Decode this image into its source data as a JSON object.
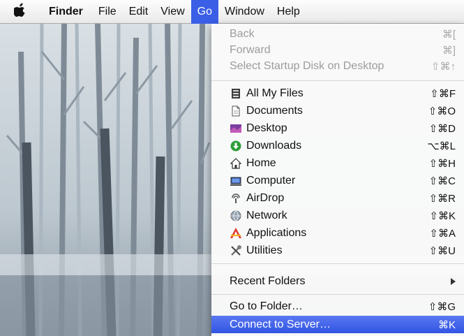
{
  "menubar": {
    "apple_icon": "apple-logo-icon",
    "items": [
      {
        "label": "Finder"
      },
      {
        "label": "File"
      },
      {
        "label": "Edit"
      },
      {
        "label": "View"
      },
      {
        "label": "Go"
      },
      {
        "label": "Window"
      },
      {
        "label": "Help"
      }
    ],
    "active_menu": "Go",
    "accent": "#3a5fe6"
  },
  "go_menu": {
    "history": [
      {
        "label": "Back",
        "shortcut": "⌘[",
        "enabled": false
      },
      {
        "label": "Forward",
        "shortcut": "⌘]",
        "enabled": false
      },
      {
        "label": "Select Startup Disk on Desktop",
        "shortcut": "⇧⌘↑",
        "enabled": false
      }
    ],
    "places": [
      {
        "label": "All My Files",
        "shortcut": "⇧⌘F",
        "icon": "all-my-files-icon"
      },
      {
        "label": "Documents",
        "shortcut": "⇧⌘O",
        "icon": "documents-icon"
      },
      {
        "label": "Desktop",
        "shortcut": "⇧⌘D",
        "icon": "desktop-icon"
      },
      {
        "label": "Downloads",
        "shortcut": "⌥⌘L",
        "icon": "downloads-icon"
      },
      {
        "label": "Home",
        "shortcut": "⇧⌘H",
        "icon": "home-icon"
      },
      {
        "label": "Computer",
        "shortcut": "⇧⌘C",
        "icon": "computer-icon"
      },
      {
        "label": "AirDrop",
        "shortcut": "⇧⌘R",
        "icon": "airdrop-icon"
      },
      {
        "label": "Network",
        "shortcut": "⇧⌘K",
        "icon": "network-icon"
      },
      {
        "label": "Applications",
        "shortcut": "⇧⌘A",
        "icon": "applications-icon"
      },
      {
        "label": "Utilities",
        "shortcut": "⇧⌘U",
        "icon": "utilities-icon"
      }
    ],
    "recent_folders": {
      "label": "Recent Folders",
      "icon": "submenu-arrow-icon"
    },
    "go_to_folder": {
      "label": "Go to Folder…",
      "shortcut": "⇧⌘G"
    },
    "connect_to_server": {
      "label": "Connect to Server…",
      "shortcut": "⌘K",
      "highlighted": true
    },
    "highlight_color": "#3a5fe6"
  }
}
